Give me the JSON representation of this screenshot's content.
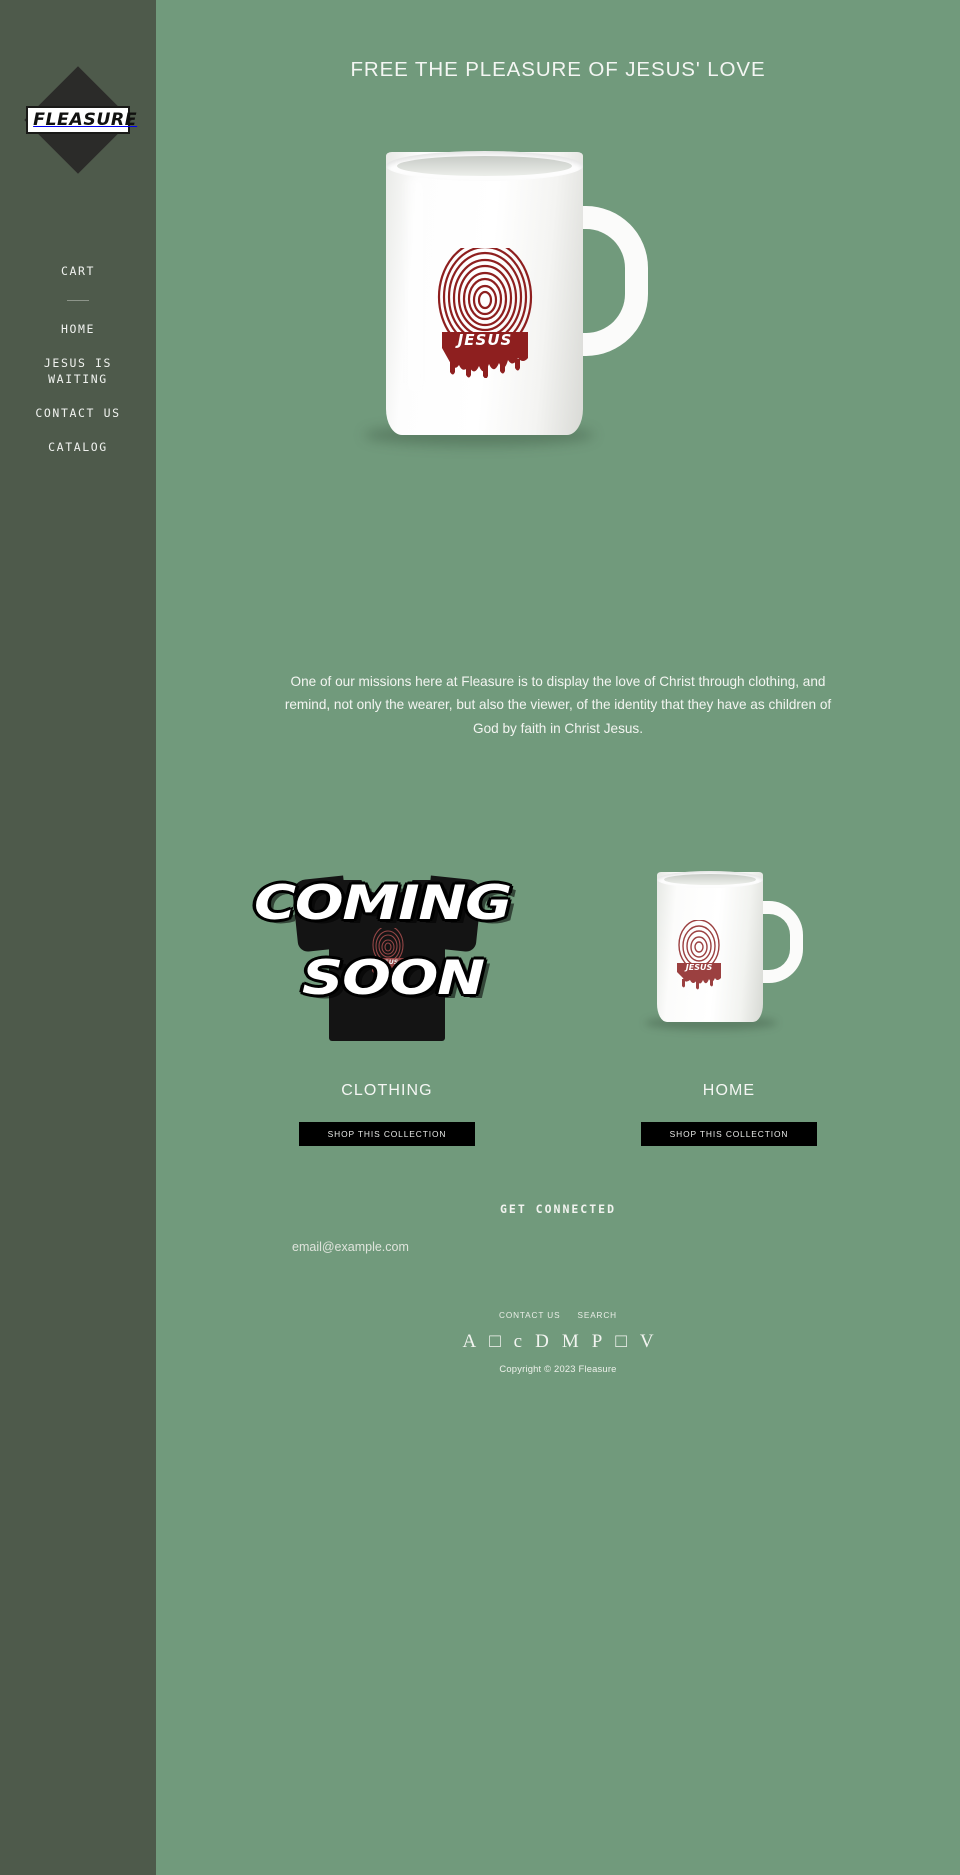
{
  "brand": {
    "logo_text": "FLEASURE",
    "logo_shape": "diamond"
  },
  "sidebar": {
    "cart_label": "CART",
    "nav_items": [
      {
        "label": "HOME"
      },
      {
        "label": "JESUS IS WAITING"
      },
      {
        "label": "CONTACT US"
      },
      {
        "label": "CATALOG"
      }
    ]
  },
  "hero": {
    "title": "FREE THE PLEASURE OF JESUS' LOVE",
    "product_art_text": "JESUS"
  },
  "mission": {
    "text": "One of our missions here at Fleasure is to display the love of Christ through clothing, and remind, not only the wearer, but also the viewer, of the identity that they have as children of God by faith in Christ Jesus."
  },
  "collections": [
    {
      "title": "CLOTHING",
      "button_label": "SHOP THIS COLLECTION",
      "overlay_line1": "COMING",
      "overlay_line2": "SOON",
      "art_text": "JESUS"
    },
    {
      "title": "HOME",
      "button_label": "SHOP THIS COLLECTION",
      "art_text": "JESUS"
    }
  ],
  "newsletter": {
    "title": "GET CONNECTED",
    "email_placeholder": "email@example.com",
    "email_value": ""
  },
  "footer": {
    "links": [
      {
        "label": "CONTACT US"
      },
      {
        "label": "SEARCH"
      }
    ],
    "payment_icons": [
      {
        "glyph": "A",
        "name": "amex-icon"
      },
      {
        "glyph": "□",
        "name": "apple-pay-icon"
      },
      {
        "glyph": "c",
        "name": "diners-club-icon"
      },
      {
        "glyph": "D",
        "name": "discover-icon"
      },
      {
        "glyph": "M",
        "name": "mastercard-icon"
      },
      {
        "glyph": "P",
        "name": "paypal-icon"
      },
      {
        "glyph": "□",
        "name": "shop-pay-icon"
      },
      {
        "glyph": "V",
        "name": "visa-icon"
      }
    ],
    "copyright": "Copyright © 2023 Fleasure"
  },
  "colors": {
    "sidebar_bg": "#4e5a4b",
    "main_bg": "#719a7c",
    "text_light": "#f2f4f0",
    "button_bg": "#000000",
    "art_red": "#8e1f1f"
  }
}
